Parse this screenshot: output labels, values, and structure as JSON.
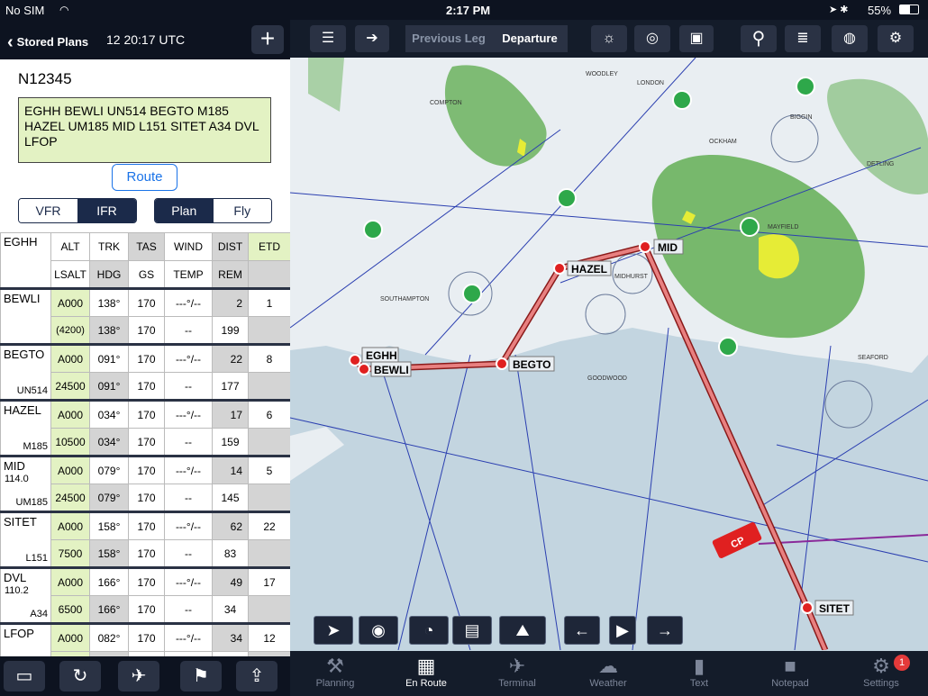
{
  "status": {
    "carrier": "No SIM",
    "time": "2:17 PM",
    "battery": "55%"
  },
  "left": {
    "back_label": "Stored Plans",
    "date": "12 20:17 UTC",
    "add": "+",
    "tail": "N12345",
    "route": "EGHH BEWLI UN514 BEGTO M185 HAZEL UM185 MID L151 SITET A34 DVL LFOP",
    "route_button": "Route",
    "seg1": [
      "VFR",
      "IFR"
    ],
    "seg2": [
      "Plan",
      "Fly"
    ],
    "header": {
      "origin": "EGHH",
      "alt": "ALT",
      "trk": "TRK",
      "tas": "TAS",
      "wind": "WIND",
      "dist": "DIST",
      "etd": "ETD",
      "lsalt": "LSALT",
      "hdg": "HDG",
      "gs": "GS",
      "temp": "TEMP",
      "rem": "REM"
    },
    "rows": [
      {
        "name": "BEWLI",
        "sub": "",
        "airway": "",
        "alt": "A000",
        "lsalt": "(4200)",
        "trk": "138°",
        "hdg": "138°",
        "tas": "170",
        "gs": "170",
        "wind": "---°/--",
        "temp": "--",
        "dist": "2",
        "rem": "199",
        "ete": "1"
      },
      {
        "name": "BEGTO",
        "sub": "",
        "airway": "UN514",
        "alt": "A000",
        "lsalt": "24500",
        "trk": "091°",
        "hdg": "091°",
        "tas": "170",
        "gs": "170",
        "wind": "---°/--",
        "temp": "--",
        "dist": "22",
        "rem": "177",
        "ete": "8"
      },
      {
        "name": "HAZEL",
        "sub": "",
        "airway": "M185",
        "alt": "A000",
        "lsalt": "10500",
        "trk": "034°",
        "hdg": "034°",
        "tas": "170",
        "gs": "170",
        "wind": "---°/--",
        "temp": "--",
        "dist": "17",
        "rem": "159",
        "ete": "6"
      },
      {
        "name": "MID",
        "sub": "114.0",
        "airway": "UM185",
        "alt": "A000",
        "lsalt": "24500",
        "trk": "079°",
        "hdg": "079°",
        "tas": "170",
        "gs": "170",
        "wind": "---°/--",
        "temp": "--",
        "dist": "14",
        "rem": "145",
        "ete": "5"
      },
      {
        "name": "SITET",
        "sub": "",
        "airway": "L151",
        "alt": "A000",
        "lsalt": "7500",
        "trk": "158°",
        "hdg": "158°",
        "tas": "170",
        "gs": "170",
        "wind": "---°/--",
        "temp": "--",
        "dist": "62",
        "rem": "83",
        "ete": "22"
      },
      {
        "name": "DVL",
        "sub": "110.2",
        "airway": "A34",
        "alt": "A000",
        "lsalt": "6500",
        "trk": "166°",
        "hdg": "166°",
        "tas": "170",
        "gs": "170",
        "wind": "---°/--",
        "temp": "--",
        "dist": "49",
        "rem": "34",
        "ete": "17"
      },
      {
        "name": "LFOP",
        "sub": "",
        "airway": "",
        "alt": "A000",
        "lsalt": "",
        "trk": "082°",
        "hdg": "",
        "tas": "170",
        "gs": "",
        "wind": "---°/--",
        "temp": "",
        "dist": "34",
        "rem": "",
        "ete": "12"
      }
    ]
  },
  "toolbar": {
    "prev_leg": "Previous Leg",
    "departure": "Departure"
  },
  "map": {
    "labels": {
      "mid": "MID",
      "hazel": "HAZEL",
      "begto": "BEGTO",
      "bewli": "BEWLI",
      "eghh": "EGHH",
      "sitet": "SITET",
      "cp": "CP"
    },
    "places": {
      "southampton": "SOUTHAMPTON",
      "goodwood": "GOODWOOD",
      "seaford": "SEAFORD",
      "midhurst": "MIDHURST",
      "ockham": "OCKHAM",
      "biggin": "BIGGIN",
      "mayfield": "MAYFIELD",
      "compton": "COMPTON",
      "detling": "DETLING",
      "woodley": "WOODLEY",
      "london": "LONDON"
    }
  },
  "tabs": [
    {
      "icon": "planning-icon",
      "label": "Planning"
    },
    {
      "icon": "en-route-icon",
      "label": "En Route"
    },
    {
      "icon": "terminal-icon",
      "label": "Terminal"
    },
    {
      "icon": "weather-icon",
      "label": "Weather"
    },
    {
      "icon": "text-icon",
      "label": "Text"
    },
    {
      "icon": "notepad-icon",
      "label": "Notepad"
    },
    {
      "icon": "settings-icon",
      "label": "Settings",
      "badge": "1"
    }
  ],
  "colors": {
    "route": "#e03b3b",
    "wx_green": "#5aaa4a",
    "wx_yellow": "#e6ec36",
    "water": "#c3d5e0",
    "land": "#e9eef2",
    "ui_dark": "#141c2a"
  }
}
